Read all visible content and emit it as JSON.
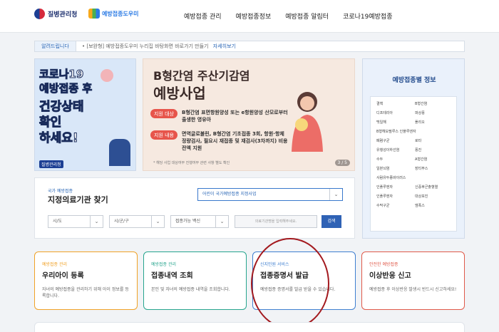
{
  "header": {
    "logo_text": "질병관리청",
    "logo2_text": "예방접종도우미",
    "nav": [
      "예방접종 관리",
      "예방접종정보",
      "예방접종 알림터",
      "코로나19예방접종"
    ]
  },
  "alert": {
    "tag": "알려드립니다",
    "text": "• [보완형] 예방접종도우미 누리집 바탕화면 바로가기 만들기",
    "more": "자세히보기"
  },
  "covid_banner": {
    "lines": [
      "코로나19",
      "예방접종 후",
      "건강상태",
      "확인",
      "하세요!"
    ],
    "logo": "질병관리청"
  },
  "hep_banner": {
    "title1": "B형간염 주산기감염",
    "title2": "예방사업",
    "rows": [
      {
        "tag": "지원 대상",
        "text": "B형간염 표면항원양성 또는 e항원양성 산모로부터 출생한 영유아"
      },
      {
        "tag": "지원 내용",
        "text": "면역글로불린, B형간염 기초접종 3회, 항원·항체 정량검사, 필요시 재접종 및 재검사(3차까지) 비용 전액 지원"
      }
    ],
    "note": "* 해당 사업 대상여부 진행여부 관련 사항 별도 확인",
    "pager": "3 / 5"
  },
  "vaccine_info": {
    "title": "예방접종별 정보",
    "items": [
      "결핵",
      "B형간염",
      "디프테리아",
      "파상풍",
      "백일해",
      "폴리오",
      "B형헤모필루스 인플루엔자",
      "폐렴구균",
      "로타",
      "유행성이하선염",
      "풍진",
      "수두",
      "A형간염",
      "일본뇌염",
      "장티푸스",
      "사람유두종바이러스",
      "인플루엔자",
      "신증후군출혈열",
      "인플루엔자",
      "대상포진",
      "수막구균",
      "엠폭스"
    ]
  },
  "search": {
    "sub": "국가 예방접종",
    "title": "지정의료기관 찾기",
    "hospital_select": "어린이 국가예방접종 지정사업",
    "sido": "시/도",
    "sigungu": "시/군/구",
    "vaccine": "접종가능 백신",
    "input_placeholder": "의료기관명을 입력해주세요.",
    "button": "검색"
  },
  "cards": [
    {
      "cat": "예방접종 관리",
      "title": "우리아이 등록",
      "desc": "자녀의 예방접종을 관리하기 위해 아이 정보를 등록합니다.",
      "color": "#f0a227"
    },
    {
      "cat": "예방접종 관리",
      "title": "접종내역 조회",
      "desc": "본인 및 자녀의 예방접종 내역을 조회합니다.",
      "color": "#27a58e"
    },
    {
      "cat": "신지민원 서비스",
      "title": "접종증명서 발급",
      "desc": "예방접종 증명서를 발급 받을 수 있습니다.",
      "color": "#3f7fd0"
    },
    {
      "cat": "안전한 예방접종",
      "title": "이상반응 신고",
      "desc": "예방접종 후 이상반응 발생시 반드시 신고하세요!",
      "color": "#e05a4a"
    }
  ]
}
